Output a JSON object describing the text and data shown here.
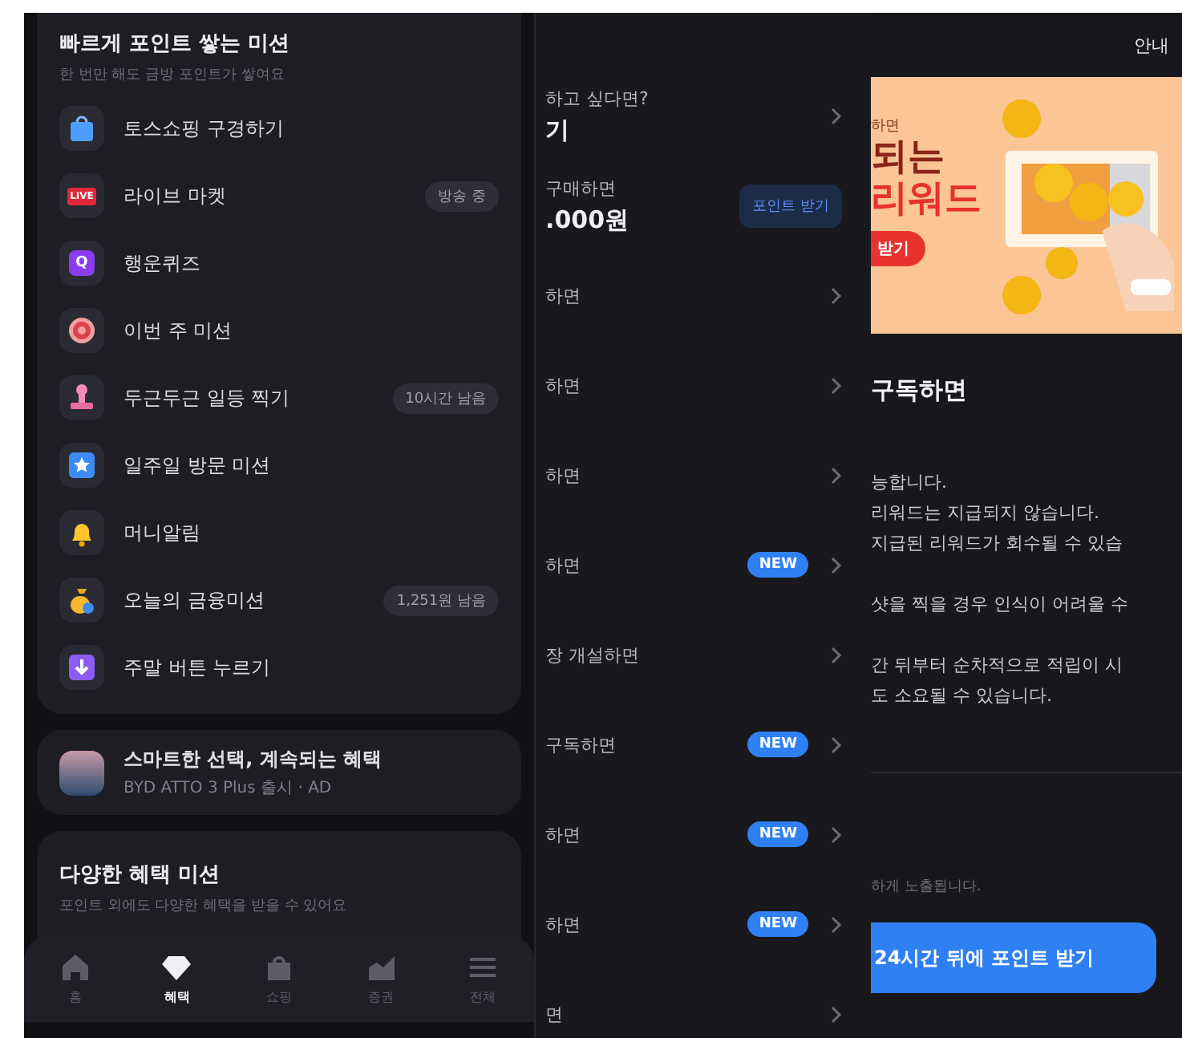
{
  "missions": {
    "title": "빠르게 포인트 쌓는 미션",
    "subtitle": "한 번만 해도 금방 포인트가 쌓여요",
    "items": [
      {
        "kind": "bag",
        "label": "토스쇼핑 구경하기"
      },
      {
        "kind": "live",
        "icon_text": "LIVE",
        "label": "라이브 마켓",
        "badge": "방송 중"
      },
      {
        "kind": "quiz",
        "icon_text": "Q",
        "label": "행운퀴즈"
      },
      {
        "kind": "target",
        "label": "이번 주 미션"
      },
      {
        "kind": "stamp",
        "label": "두근두근 일등 찍기",
        "badge": "10시간 남음"
      },
      {
        "kind": "star",
        "label": "일주일 방문 미션"
      },
      {
        "kind": "bell",
        "label": "머니알림"
      },
      {
        "kind": "moneybag",
        "label": "오늘의 금융미션",
        "badge": "1,251원 남음"
      },
      {
        "kind": "download",
        "label": "주말 버튼 누르기"
      }
    ]
  },
  "ad": {
    "title": "스마트한 선택, 계속되는 혜택",
    "subtitle": "BYD ATTO 3 Plus 출시 · AD"
  },
  "benefit_missions": {
    "title": "다양한 혜택 미션",
    "subtitle": "포인트 외에도 다양한 혜택을 받을 수 있어요"
  },
  "tab_bar": [
    {
      "kind": "home",
      "label": "홈",
      "selected": false
    },
    {
      "kind": "gem",
      "label": "혜택",
      "selected": true
    },
    {
      "kind": "bag",
      "label": "쇼핑",
      "selected": false
    },
    {
      "kind": "chart",
      "label": "증권",
      "selected": false
    },
    {
      "kind": "menu",
      "label": "전체",
      "selected": false
    }
  ],
  "middle_list": [
    {
      "kind": "chevron",
      "line1": "하고 싶다면?",
      "line2": "기"
    },
    {
      "kind": "button",
      "line1": "구매하면",
      "line2": ".000원",
      "button": "포인트 받기"
    },
    {
      "kind": "chevron",
      "line1": "하면"
    },
    {
      "kind": "chevron",
      "line1": "하면"
    },
    {
      "kind": "chevron",
      "line1": "하면"
    },
    {
      "kind": "new",
      "line1": "하면",
      "badge": "NEW"
    },
    {
      "kind": "chevron",
      "line1": "장 개설하면"
    },
    {
      "kind": "new",
      "line1": "구독하면",
      "badge": "NEW"
    },
    {
      "kind": "new",
      "line1": "하면",
      "badge": "NEW"
    },
    {
      "kind": "new",
      "line1": "하면",
      "badge": "NEW"
    },
    {
      "kind": "chevron",
      "line1": "면"
    }
  ],
  "detail": {
    "header_action": "안내",
    "banner": {
      "line1": "하면",
      "line2": "되는",
      "line3": "리워드",
      "button": "받기"
    },
    "heading": "구독하면",
    "notes": [
      "능합니다.",
      "리워드는 지급되지 않습니다.",
      "지급된 리워드가 회수될 수 있습",
      "샷을 찍을 경우 인식이 어려울 수",
      "간 뒤부터 순차적으로 적립이 시",
      "도 소요될 수 있습니다."
    ],
    "footnote": "하게 노출됩니다.",
    "cta": "24시간 뒤에 포인트 받기"
  }
}
